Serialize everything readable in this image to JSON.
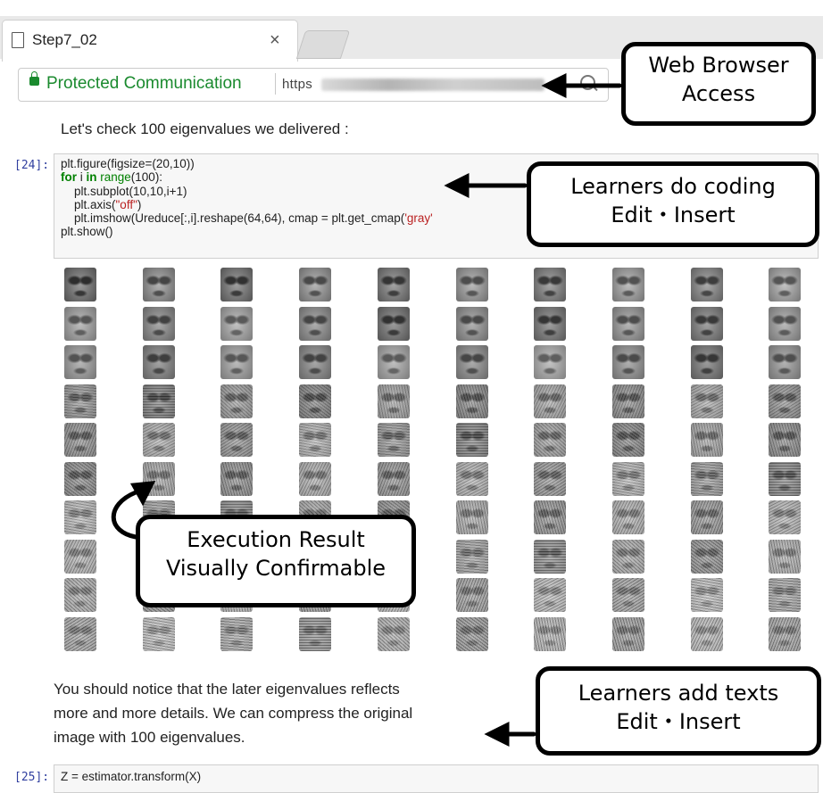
{
  "browser": {
    "tab_title": "Step7_02",
    "tab_close": "×",
    "security_label": "Protected Communication",
    "url_prefix": "https"
  },
  "callouts": {
    "browser_line1": "Web Browser",
    "browser_line2": "Access",
    "coding_line1": "Learners do coding",
    "coding_line2": "Edit・Insert",
    "exec_line1": "Execution Result",
    "exec_line2": "Visually Confirmable",
    "texts_line1": "Learners add texts",
    "texts_line2": "Edit・Insert"
  },
  "notebook": {
    "markdown1": "Let's check 100 eigenvalues we delivered :",
    "cell24": {
      "prompt": "[24]:",
      "l1": "plt.figure(figsize=(20,10))",
      "l2_for": "for",
      "l2_i": " i ",
      "l2_in": "in",
      "l2_range": " range",
      "l2_rest": "(100):",
      "l3": "    plt.subplot(10,10,i+1)",
      "l4_a": "    plt.axis(",
      "l4_str": "\"off\"",
      "l4_b": ")",
      "l5_a": "    plt.imshow(Ureduce[:,i].reshape(64,64), cmap = plt.get_cmap(",
      "l5_str": "'gray'",
      "l6": "plt.show()"
    },
    "markdown2_l1": "You should notice that the later eigenvalues reflects",
    "markdown2_l2": "more and more details.  We can compress the original",
    "markdown2_l3": "image with 100 eigenvalues.",
    "cell25": {
      "prompt": "[25]:",
      "code": "Z = estimator.transform(X)"
    }
  },
  "output": {
    "rows": 10,
    "cols": 10,
    "item_label": "eigenface-image"
  }
}
